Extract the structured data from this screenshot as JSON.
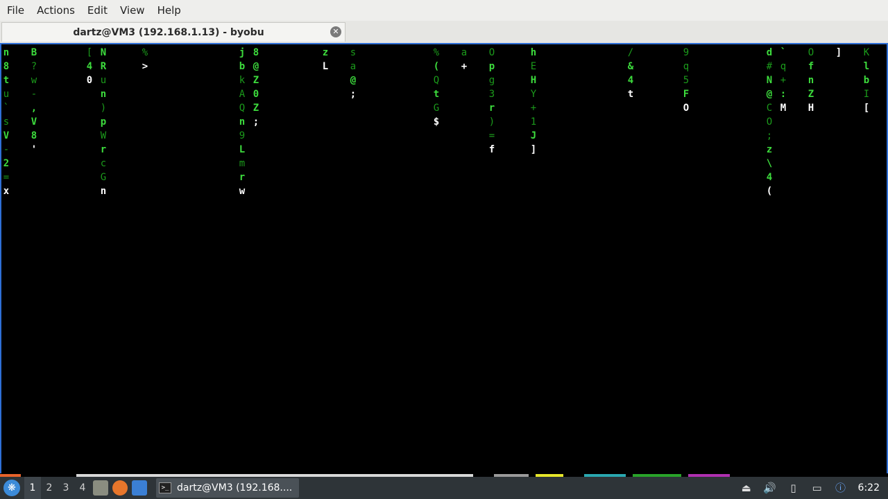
{
  "menubar": {
    "items": [
      "File",
      "Actions",
      "Edit",
      "View",
      "Help"
    ]
  },
  "tab": {
    "title": "dartz@VM3 (192.168.1.13) - byobu"
  },
  "terminal": {
    "columns": [
      [
        [
          "n",
          "b"
        ],
        [
          "8",
          "b"
        ],
        [
          "t",
          "b"
        ],
        [
          "u",
          "d"
        ],
        [
          "`",
          "d"
        ],
        [
          "s",
          "d"
        ],
        [
          "V",
          "b"
        ],
        [
          "-",
          "d"
        ],
        [
          "2",
          "b"
        ],
        [
          "=",
          "d"
        ],
        [
          "x",
          "w"
        ]
      ],
      [
        [
          "B",
          "b"
        ],
        [
          "?",
          "d"
        ],
        [
          "w",
          "d"
        ],
        [
          "-",
          "d"
        ],
        [
          ",",
          "b"
        ],
        [
          "V",
          "b"
        ],
        [
          "8",
          "b"
        ],
        [
          "'",
          "w"
        ]
      ],
      [
        [
          "[",
          "d"
        ],
        [
          "4",
          "b"
        ],
        [
          "0",
          "w"
        ]
      ],
      [
        [
          "N",
          "b"
        ],
        [
          "R",
          "b"
        ],
        [
          "u",
          "d"
        ],
        [
          "n",
          "b"
        ],
        [
          ")",
          "d"
        ],
        [
          "p",
          "b"
        ],
        [
          "W",
          "d"
        ],
        [
          "r",
          "b"
        ],
        [
          "c",
          "d"
        ],
        [
          "G",
          "d"
        ],
        [
          "n",
          "w"
        ]
      ],
      [
        [
          "%",
          "d"
        ],
        [
          ">",
          "w"
        ]
      ],
      [
        [
          "j",
          "b"
        ],
        [
          "b",
          "b"
        ],
        [
          "k",
          "d"
        ],
        [
          "A",
          "d"
        ],
        [
          "Q",
          "d"
        ],
        [
          "n",
          "b"
        ],
        [
          "9",
          "d"
        ],
        [
          "L",
          "b"
        ],
        [
          "m",
          "d"
        ],
        [
          "r",
          "b"
        ],
        [
          "w",
          "w"
        ]
      ],
      [
        [
          "8",
          "b"
        ],
        [
          "@",
          "b"
        ],
        [
          "Z",
          "b"
        ],
        [
          "0",
          "b"
        ],
        [
          "Z",
          "b"
        ],
        [
          ";",
          "w"
        ]
      ],
      [
        [
          "z",
          "b"
        ],
        [
          "L",
          "w"
        ]
      ],
      [
        [
          "s",
          "d"
        ],
        [
          "a",
          "d"
        ],
        [
          "@",
          "b"
        ],
        [
          ";",
          "w"
        ]
      ],
      [
        [
          "%",
          "d"
        ],
        [
          "(",
          "b"
        ],
        [
          "Q",
          "d"
        ],
        [
          "t",
          "b"
        ],
        [
          "G",
          "d"
        ],
        [
          "$",
          "w"
        ]
      ],
      [
        [
          "a",
          "d"
        ],
        [
          "+",
          "w"
        ]
      ],
      [
        [
          "O",
          "d"
        ],
        [
          "p",
          "b"
        ],
        [
          "g",
          "d"
        ],
        [
          "3",
          "d"
        ],
        [
          "r",
          "b"
        ],
        [
          ")",
          "d"
        ],
        [
          "=",
          "d"
        ],
        [
          "f",
          "w"
        ]
      ],
      [
        [
          "h",
          "b"
        ],
        [
          "E",
          "d"
        ],
        [
          "H",
          "b"
        ],
        [
          "Y",
          "d"
        ],
        [
          "+",
          "d"
        ],
        [
          "1",
          "d"
        ],
        [
          "J",
          "b"
        ],
        [
          "]",
          "w"
        ]
      ],
      [
        [
          "/",
          "d"
        ],
        [
          "&",
          "b"
        ],
        [
          "4",
          "b"
        ],
        [
          "t",
          "w"
        ]
      ],
      [
        [
          "9",
          "d"
        ],
        [
          "q",
          "d"
        ],
        [
          "5",
          "d"
        ],
        [
          "F",
          "b"
        ],
        [
          "O",
          "w"
        ]
      ],
      [
        [
          "d",
          "b"
        ],
        [
          "#",
          "d"
        ],
        [
          "N",
          "b"
        ],
        [
          "@",
          "b"
        ],
        [
          "C",
          "d"
        ],
        [
          "O",
          "d"
        ],
        [
          ";",
          "d"
        ],
        [
          "z",
          "b"
        ],
        [
          "\\",
          "b"
        ],
        [
          "4",
          "b"
        ],
        [
          "(",
          "w"
        ]
      ],
      [
        [
          "`",
          "b"
        ],
        [
          "q",
          "d"
        ],
        [
          "+",
          "d"
        ],
        [
          ":",
          "b"
        ],
        [
          "M",
          "w"
        ]
      ],
      [
        [
          "O",
          "d"
        ],
        [
          "f",
          "b"
        ],
        [
          "n",
          "b"
        ],
        [
          "Z",
          "b"
        ],
        [
          "H",
          "w"
        ]
      ],
      [
        [
          "]",
          "w"
        ]
      ],
      [
        [
          "K",
          "d"
        ],
        [
          "l",
          "b"
        ],
        [
          "b",
          "b"
        ],
        [
          "I",
          "d"
        ],
        [
          "[",
          "w"
        ]
      ]
    ]
  },
  "panel": {
    "workspaces": [
      "1",
      "2",
      "3",
      "4"
    ],
    "task_title": "dartz@VM3 (192.168....",
    "task_icon": ">_",
    "clock": "6:22"
  },
  "colors": {
    "bright_green": "#3ddc3d",
    "dim_green": "#1b9a1b",
    "white": "#ffffff",
    "accent": "#2f6fd6"
  }
}
